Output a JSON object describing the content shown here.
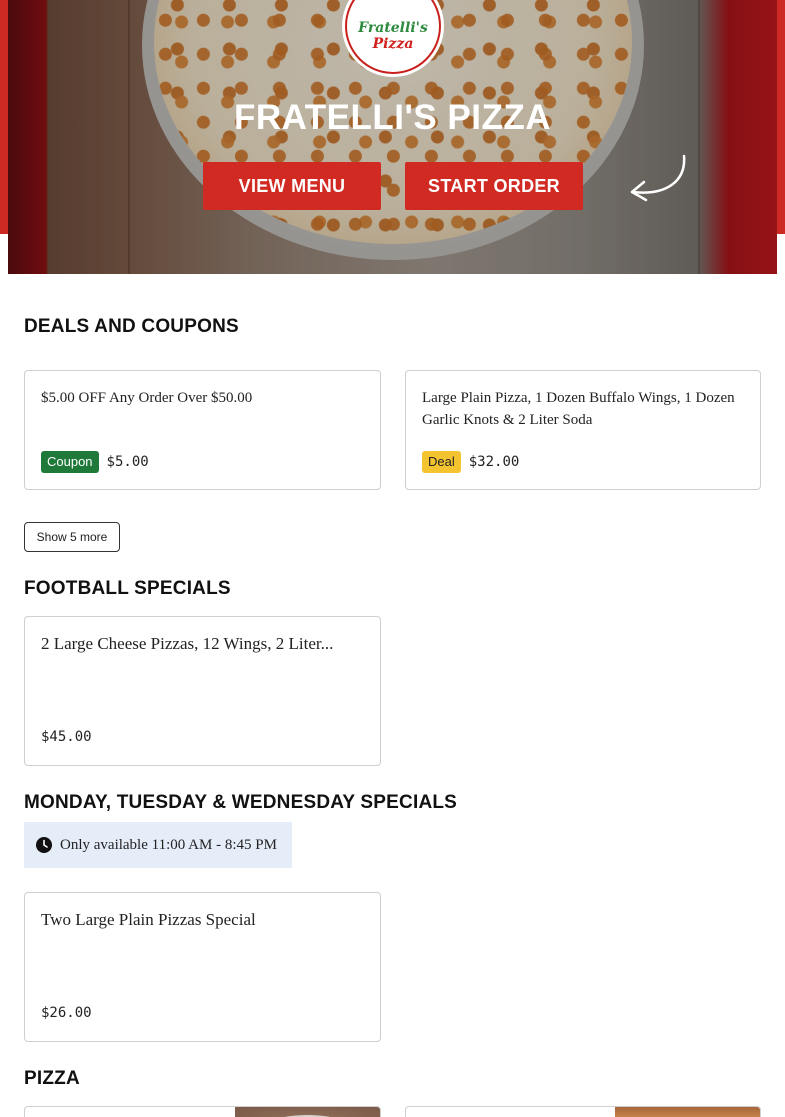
{
  "hero": {
    "logo_line1": "Fratelli's",
    "logo_line2": "Pizza",
    "title": "FRATELLI'S PIZZA",
    "view_menu_label": "VIEW MENU",
    "start_order_label": "START ORDER"
  },
  "deals": {
    "title": "DEALS AND COUPONS",
    "items": [
      {
        "name": "$5.00 OFF Any Order Over $50.00",
        "badge": "Coupon",
        "price": "$5.00"
      },
      {
        "name": "Large Plain Pizza, 1 Dozen Buffalo Wings, 1 Dozen Garlic Knots & 2 Liter Soda",
        "badge": "Deal",
        "price": "$32.00"
      }
    ],
    "show_more_label": "Show 5 more"
  },
  "football": {
    "title": "FOOTBALL SPECIALS",
    "items": [
      {
        "name": "2 Large Cheese Pizzas, 12 Wings, 2 Liter...",
        "price": "$45.00"
      }
    ]
  },
  "mtw": {
    "title": "MONDAY, TUESDAY & WEDNESDAY SPECIALS",
    "availability": "Only available 11:00 AM - 8:45 PM",
    "items": [
      {
        "name": "Two Large Plain Pizzas Special",
        "price": "$26.00"
      }
    ]
  },
  "pizza": {
    "title": "PIZZA"
  },
  "colors": {
    "brand_red": "#d12a22",
    "coupon_green": "#1f7a3a",
    "deal_yellow": "#f4c430",
    "availability_bg": "#e5edf8"
  },
  "icons": {
    "clock": "clock-icon",
    "arrow": "curved-arrow-icon"
  }
}
